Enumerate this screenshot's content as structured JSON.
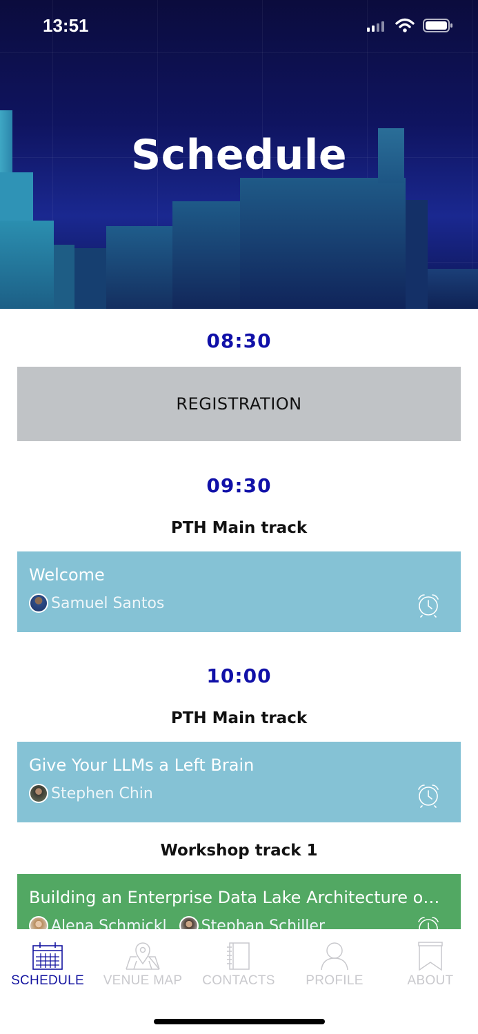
{
  "status_bar": {
    "time": "13:51"
  },
  "header": {
    "title": "Schedule"
  },
  "schedule": {
    "slots": [
      {
        "time": "08:30",
        "registration_label": "REGISTRATION"
      },
      {
        "time": "09:30",
        "track": "PTH Main track",
        "session": {
          "title": "Welcome",
          "speakers": [
            "Samuel Santos"
          ]
        }
      },
      {
        "time": "10:00",
        "track": "PTH Main track",
        "session": {
          "title": "Give Your LLMs a Left Brain",
          "speakers": [
            "Stephen Chin"
          ]
        },
        "track_2": "Workshop track 1",
        "session_2": {
          "title": "Building an Enterprise Data Lake Architecture on ...",
          "speakers": [
            "Alena Schmickl",
            "Stephan Schiller"
          ]
        }
      }
    ]
  },
  "tabs": [
    {
      "label": "SCHEDULE",
      "icon": "calendar-icon",
      "active": true
    },
    {
      "label": "VENUE MAP",
      "icon": "map-icon",
      "active": false
    },
    {
      "label": "CONTACTS",
      "icon": "contacts-book-icon",
      "active": false
    },
    {
      "label": "PROFILE",
      "icon": "person-icon",
      "active": false
    },
    {
      "label": "ABOUT",
      "icon": "bookmark-icon",
      "active": false
    }
  ],
  "colors": {
    "accent": "#1414a0",
    "registration_bg": "#c0c3c6",
    "main_track_bg": "#85c2d5",
    "workshop_bg": "#52a863",
    "tab_inactive": "#c9c9cd"
  }
}
